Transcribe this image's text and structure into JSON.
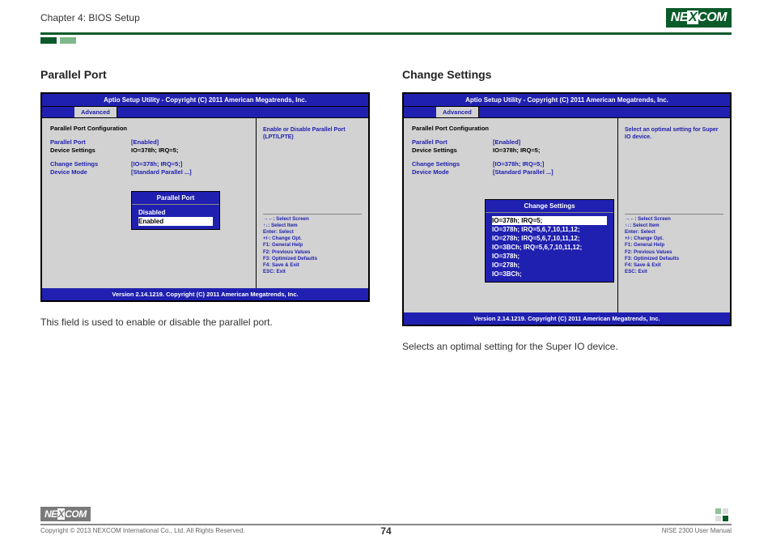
{
  "header": {
    "chapter": "Chapter 4: BIOS Setup",
    "logo_text_pre": "NE",
    "logo_text_x": "X",
    "logo_text_post": "COM"
  },
  "left": {
    "title": "Parallel Port",
    "bios": {
      "titlebar": "Aptio Setup Utility - Copyright (C) 2011 American Megatrends, Inc.",
      "tab": "Advanced",
      "heading": "Parallel Port Configuration",
      "rows": [
        {
          "lbl": "Parallel Port",
          "val": "[Enabled]",
          "lbl_cls": "blue",
          "val_cls": "blue"
        },
        {
          "lbl": "Device Settings",
          "val": "IO=378h; IRQ=5;",
          "lbl_cls": "black",
          "val_cls": "black"
        }
      ],
      "rows2": [
        {
          "lbl": "Change Settings",
          "val": "[IO=378h; IRQ=5;]",
          "lbl_cls": "blue",
          "val_cls": "blue"
        },
        {
          "lbl": "Device Mode",
          "val": "[Standard Parallel ...]",
          "lbl_cls": "blue",
          "val_cls": "blue"
        }
      ],
      "help": "Enable or Disable Parallel Port (LPT/LPTE)",
      "popup": {
        "title": "Parallel Port",
        "items": [
          {
            "text": "Disabled",
            "selected": false
          },
          {
            "text": "Enabled",
            "selected": true
          }
        ]
      },
      "nav": [
        "→←: Select Screen",
        "↑↓: Select Item",
        "Enter: Select",
        "+/-: Change Opt.",
        "F1: General Help",
        "F2: Previous Values",
        "F3: Optimized Defaults",
        "F4: Save & Exit",
        "ESC: Exit"
      ],
      "footer": "Version 2.14.1219. Copyright (C) 2011 American Megatrends, Inc."
    },
    "caption": "This field is used to enable or disable the parallel port."
  },
  "right": {
    "title": "Change Settings",
    "bios": {
      "titlebar": "Aptio Setup Utility - Copyright (C) 2011 American Megatrends, Inc.",
      "tab": "Advanced",
      "heading": "Parallel Port Configuration",
      "rows": [
        {
          "lbl": "Parallel Port",
          "val": "[Enabled]",
          "lbl_cls": "blue",
          "val_cls": "blue"
        },
        {
          "lbl": "Device Settings",
          "val": "IO=378h; IRQ=5;",
          "lbl_cls": "black",
          "val_cls": "black"
        }
      ],
      "rows2": [
        {
          "lbl": "Change Settings",
          "val": "[IO=378h; IRQ=5;]",
          "lbl_cls": "blue",
          "val_cls": "blue"
        },
        {
          "lbl": "Device Mode",
          "val": "[Standard Parallel ...]",
          "lbl_cls": "blue",
          "val_cls": "blue"
        }
      ],
      "help": "Select an optimal setting for Super IO device.",
      "popup": {
        "title": "Change Settings",
        "items": [
          {
            "text": "IO=378h; IRQ=5;",
            "selected": true
          },
          {
            "text": "IO=378h; IRQ=5,6,7,10,11,12;",
            "selected": false
          },
          {
            "text": "IO=278h; IRQ=5,6,7,10,11,12;",
            "selected": false
          },
          {
            "text": "IO=3BCh; IRQ=5,6,7,10,11,12;",
            "selected": false
          },
          {
            "text": "IO=378h;",
            "selected": false
          },
          {
            "text": "IO=278h;",
            "selected": false
          },
          {
            "text": "IO=3BCh;",
            "selected": false
          }
        ]
      },
      "nav": [
        "→←: Select Screen",
        "↑↓: Select Item",
        "Enter: Select",
        "+/-: Change Opt.",
        "F1: General Help",
        "F2: Previous Values",
        "F3: Optimized Defaults",
        "F4: Save & Exit",
        "ESC: Exit"
      ],
      "footer": "Version 2.14.1219. Copyright (C) 2011 American Megatrends, Inc."
    },
    "caption": "Selects an optimal setting for the Super IO device."
  },
  "footer": {
    "copyright": "Copyright © 2013 NEXCOM International Co., Ltd. All Rights Reserved.",
    "page": "74",
    "manual": "NISE 2300 User Manual"
  }
}
